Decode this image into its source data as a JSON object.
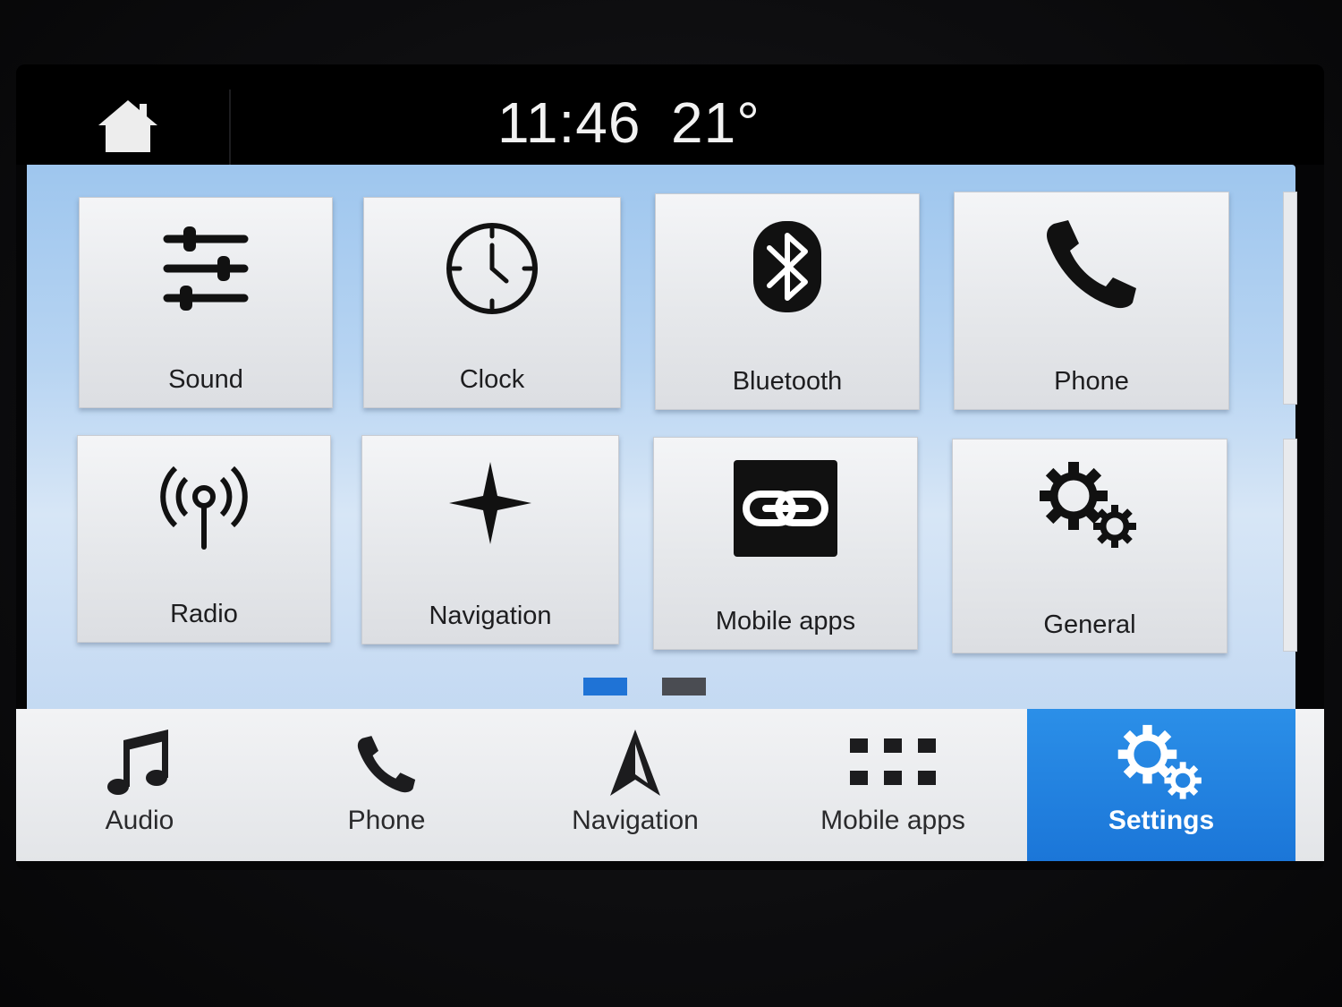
{
  "status_bar": {
    "time": "11:46",
    "temperature": "21°",
    "home_icon": "home-icon"
  },
  "tiles": [
    {
      "label": "Sound",
      "icon": "equalizer-icon"
    },
    {
      "label": "Clock",
      "icon": "clock-icon"
    },
    {
      "label": "Bluetooth",
      "icon": "bluetooth-icon"
    },
    {
      "label": "Phone",
      "icon": "phone-icon"
    },
    {
      "label": "Radio",
      "icon": "radio-icon"
    },
    {
      "label": "Navigation",
      "icon": "navigation-star-icon"
    },
    {
      "label": "Mobile apps",
      "icon": "link-icon"
    },
    {
      "label": "General",
      "icon": "gears-icon"
    }
  ],
  "pagination": {
    "pages": 2,
    "current": 1,
    "active_color": "#1f73d6",
    "inactive_color": "#4a4c52"
  },
  "bottom_nav": [
    {
      "label": "Audio",
      "icon": "music-note-icon",
      "active": false
    },
    {
      "label": "Phone",
      "icon": "phone-icon",
      "active": false
    },
    {
      "label": "Navigation",
      "icon": "navigation-arrow-icon",
      "active": false
    },
    {
      "label": "Mobile apps",
      "icon": "apps-grid-icon",
      "active": false
    },
    {
      "label": "Settings",
      "icon": "gears-icon",
      "active": true
    }
  ],
  "colors": {
    "accent": "#1b76d8",
    "content_background": "#b7d4f2",
    "tile_background": "#e6e8eb"
  }
}
